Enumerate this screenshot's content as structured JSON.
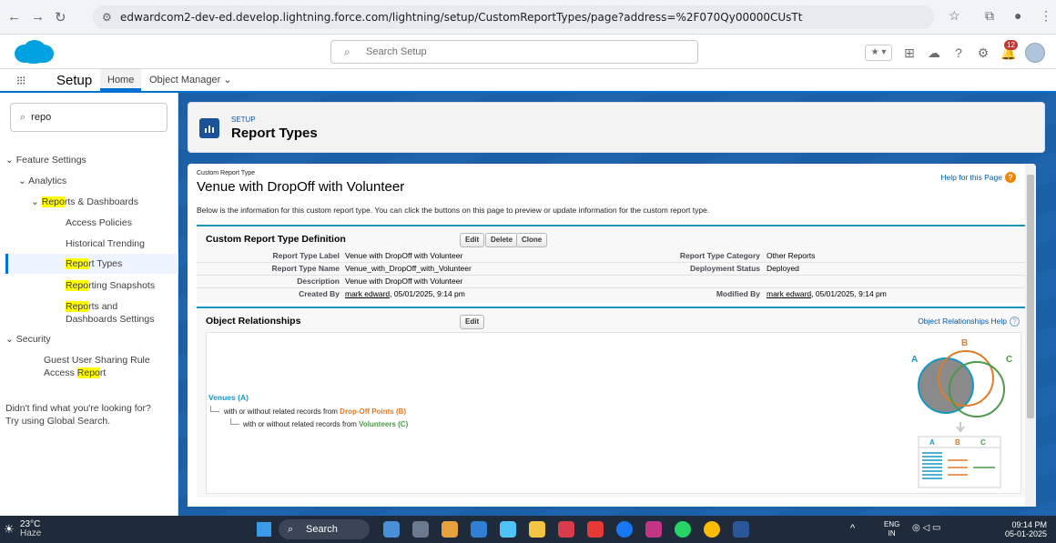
{
  "browser": {
    "url": "edwardcom2-dev-ed.develop.lightning.force.com/lightning/setup/CustomReportTypes/page?address=%2F070Qy00000CUsTt"
  },
  "header": {
    "search_placeholder": "Search Setup",
    "notification_count": "12"
  },
  "tabbar": {
    "app_title": "Setup",
    "tabs": [
      "Home",
      "Object Manager"
    ]
  },
  "sidebar": {
    "quickfind_value": "repo",
    "items": [
      {
        "label": "Feature Settings"
      },
      {
        "label": "Analytics"
      },
      {
        "label_hl": "Repo",
        "label_rest": "rts & Dashboards"
      },
      {
        "label": "Access Policies"
      },
      {
        "label": "Historical Trending"
      },
      {
        "label_hl": "Repo",
        "label_rest": "rt Types"
      },
      {
        "label_hl": "Repo",
        "label_rest": "rting Snapshots"
      },
      {
        "label_hl": "Repo",
        "label_rest": "rts and Dashboards Settings"
      },
      {
        "label": "Security"
      },
      {
        "label_pre": "Guest User Sharing Rule Access ",
        "label_hl": "Repo",
        "label_rest": "rt"
      }
    ],
    "not_found_line1": "Didn't find what you're looking for?",
    "not_found_line2": "Try using Global Search."
  },
  "page_header": {
    "overline": "SETUP",
    "title": "Report Types"
  },
  "detail": {
    "overline": "Custom Report Type",
    "title": "Venue with DropOff with Volunteer",
    "help_link": "Help for this Page",
    "description": "Below is the information for this custom report type. You can click the buttons on this page to preview or update information for the custom report type.",
    "section_title": "Custom Report Type Definition",
    "buttons": [
      "Edit",
      "Delete",
      "Clone"
    ],
    "fields": {
      "label_k": "Report Type Label",
      "label_v": "Venue with DropOff with Volunteer",
      "name_k": "Report Type Name",
      "name_v": "Venue_with_DropOff_with_Volunteer",
      "desc_k": "Description",
      "desc_v": "Venue with DropOff with Volunteer",
      "created_k": "Created By",
      "created_user": "mark edward",
      "created_date": ", 05/01/2025, 9:14 pm",
      "category_k": "Report Type Category",
      "category_v": "Other Reports",
      "status_k": "Deployment Status",
      "status_v": "Deployed",
      "modified_k": "Modified By",
      "modified_user": "mark edward",
      "modified_date": ", 05/01/2025, 9:14 pm"
    }
  },
  "relationships": {
    "section_title": "Object Relationships",
    "edit_label": "Edit",
    "help_link": "Object Relationships Help",
    "a_label": "Venues (A)",
    "b_prefix": "with or without related records from ",
    "b_label": "Drop-Off Points (B)",
    "c_prefix": "with or without related records from ",
    "c_label": "Volunteers (C)",
    "venn_a": "A",
    "venn_b": "B",
    "venn_c": "C",
    "colors": {
      "a": "#1797c0",
      "b": "#e07b2a",
      "c": "#4a9a4a"
    }
  },
  "taskbar": {
    "temp": "23°C",
    "weather": "Haze",
    "search": "Search",
    "lang1": "ENG",
    "lang2": "IN",
    "time": "09:14 PM",
    "date": "05-01-2025"
  }
}
